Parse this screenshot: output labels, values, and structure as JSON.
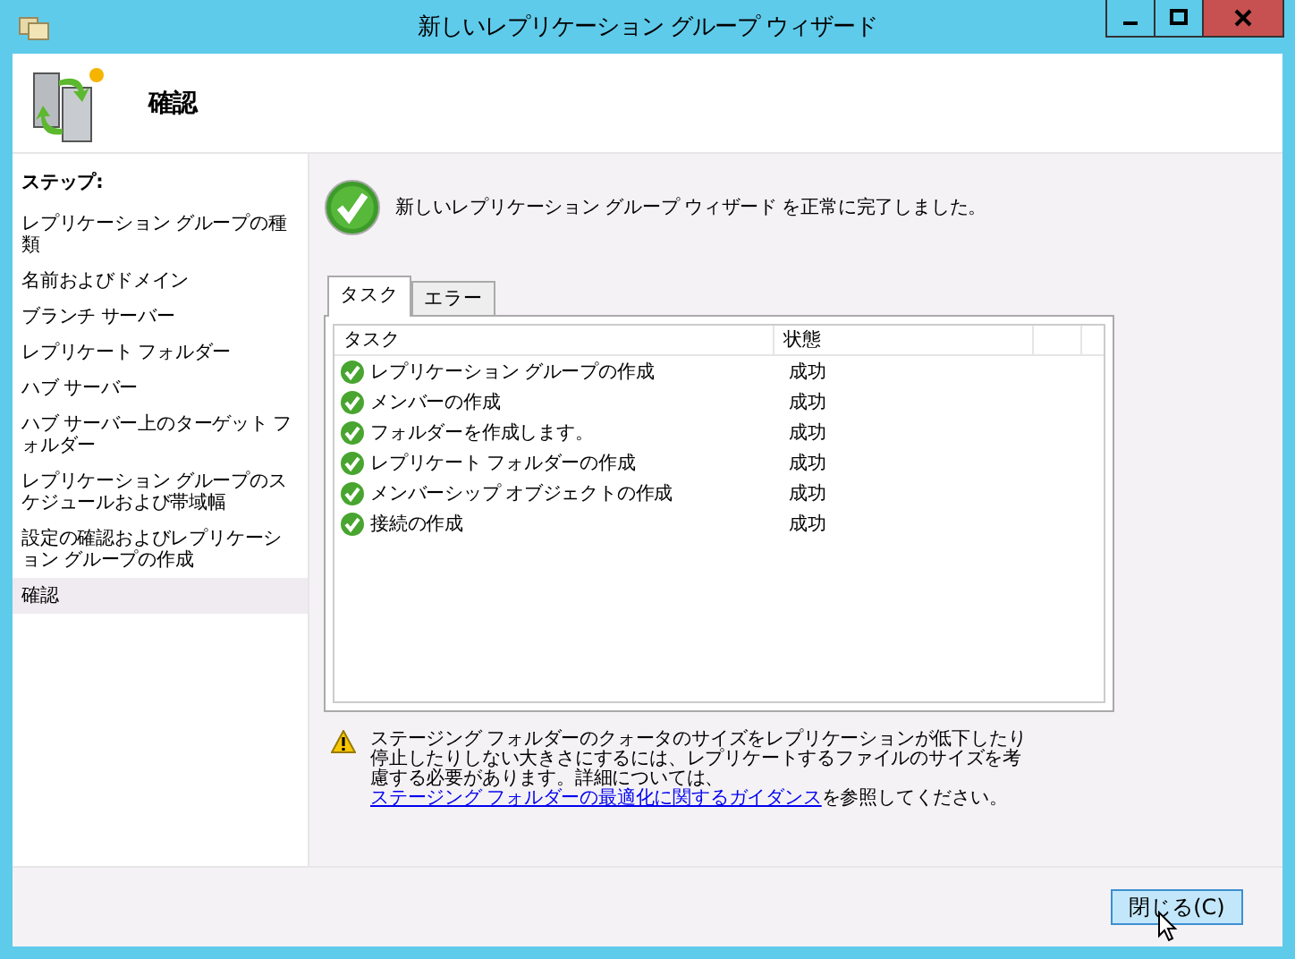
{
  "window": {
    "title": "新しいレプリケーション グループ ウィザード"
  },
  "header": {
    "title": "確認"
  },
  "sidebar": {
    "heading": "ステップ:",
    "items": [
      {
        "label": "レプリケーション グループの種類",
        "selected": false
      },
      {
        "label": "名前およびドメイン",
        "selected": false
      },
      {
        "label": "ブランチ サーバー",
        "selected": false
      },
      {
        "label": "レプリケート フォルダー",
        "selected": false
      },
      {
        "label": "ハブ サーバー",
        "selected": false
      },
      {
        "label": "ハブ サーバー上のターゲット フォルダー",
        "selected": false
      },
      {
        "label": "レプリケーション グループのスケジュールおよび帯域幅",
        "selected": false
      },
      {
        "label": "設定の確認およびレプリケーション グループの作成",
        "selected": false
      },
      {
        "label": "確認",
        "selected": true
      }
    ]
  },
  "result": {
    "message": "新しいレプリケーション グループ ウィザード を正常に完了しました。"
  },
  "tabs": [
    {
      "label": "タスク",
      "selected": true
    },
    {
      "label": "エラー",
      "selected": false
    }
  ],
  "table": {
    "columns": [
      "タスク",
      "状態"
    ],
    "rows": [
      {
        "task": "レプリケーション グループの作成",
        "status": "成功"
      },
      {
        "task": "メンバーの作成",
        "status": "成功"
      },
      {
        "task": "フォルダーを作成します。",
        "status": "成功"
      },
      {
        "task": "レプリケート フォルダーの作成",
        "status": "成功"
      },
      {
        "task": "メンバーシップ オブジェクトの作成",
        "status": "成功"
      },
      {
        "task": "接続の作成",
        "status": "成功"
      }
    ]
  },
  "warning": {
    "text": "ステージング フォルダーのクォータのサイズをレプリケーションが低下したり停止したりしない大きさにするには、レプリケートするファイルのサイズを考慮する必要があります。詳細については、",
    "link": "ステージング フォルダーの最適化に関するガイダンス",
    "after": "を参照してください。"
  },
  "buttons": [
    "閉じる(C)"
  ]
}
